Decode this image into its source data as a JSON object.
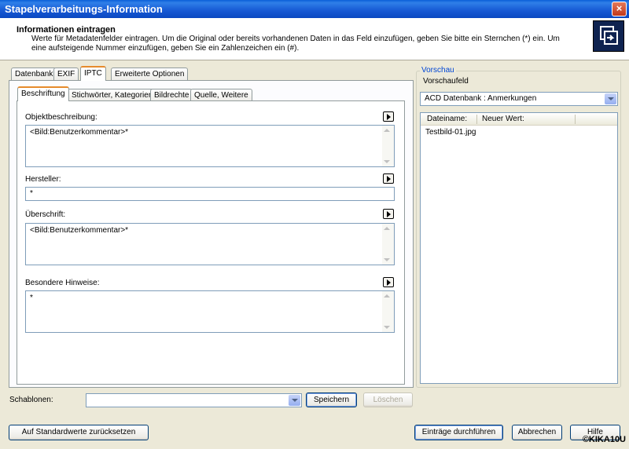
{
  "window": {
    "title": "Stapelverarbeitungs-Information",
    "close_glyph": "×"
  },
  "header": {
    "title": "Informationen eintragen",
    "description": "Werte für Metadatenfelder eintragen. Um die Original oder bereits vorhandenen Daten in das Feld einzufügen, geben Sie bitte ein Sternchen (*) ein. Um eine aufsteigende Nummer einzufügen, geben Sie ein Zahlenzeichen ein (#)."
  },
  "tabs": [
    "Datenbank",
    "EXIF",
    "IPTC",
    "Erweiterte Optionen"
  ],
  "subtabs": [
    "Beschriftung",
    "Stichwörter, Kategorien",
    "Bildrechte",
    "Quelle, Weitere"
  ],
  "fields": {
    "objektbeschreibung": {
      "label": "Objektbeschreibung:",
      "value": "<Bild:Benutzerkommentar>*"
    },
    "hersteller": {
      "label": "Hersteller:",
      "value": "*"
    },
    "ueberschrift": {
      "label": "Überschrift:",
      "value": "<Bild:Benutzerkommentar>*"
    },
    "hinweise": {
      "label": "Besondere Hinweise:",
      "value": "*"
    }
  },
  "template": {
    "label": "Schablonen:",
    "value": "",
    "save": "Speichern",
    "delete": "Löschen"
  },
  "preview": {
    "group_title": "Vorschau",
    "field_label": "Vorschaufeld",
    "selected": "ACD Datenbank : Anmerkungen",
    "columns": [
      "Dateiname:",
      "Neuer Wert:"
    ],
    "rows": [
      {
        "file": "Testbild-01.jpg",
        "value": ""
      }
    ]
  },
  "buttons": {
    "reset": "Auf Standardwerte zurücksetzen",
    "apply": "Einträge durchführen",
    "cancel": "Abbrechen",
    "help": "Hilfe"
  },
  "watermark": "©KIKA10U",
  "colors": {
    "titlebar": "#0a5fd8",
    "accent_tab": "#e68b2c",
    "group_legend": "#0046d5"
  }
}
